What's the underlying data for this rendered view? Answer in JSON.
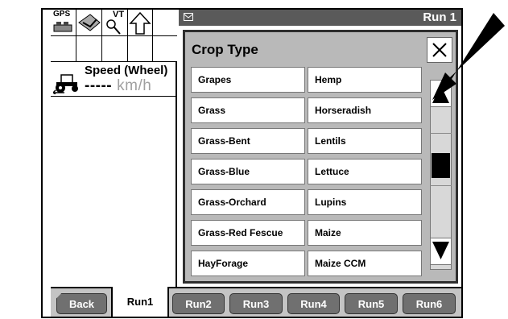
{
  "status_icons": {
    "gps_label": "GPS",
    "vt_label": "VT"
  },
  "speed": {
    "title": "Speed (Wheel)",
    "value": "-----",
    "unit": "km/h"
  },
  "header": {
    "title": "Run 1"
  },
  "dialog": {
    "title": "Crop Type",
    "items_left": [
      "Grapes",
      "Grass",
      "Grass-Bent",
      "Grass-Blue",
      "Grass-Orchard",
      "Grass-Red Fescue",
      "HayForage"
    ],
    "items_right": [
      "Hemp",
      "Horseradish",
      "Lentils",
      "Lettuce",
      "Lupins",
      "Maize",
      "Maize CCM"
    ]
  },
  "tabs": {
    "back": "Back",
    "run1": "Run1",
    "run2": "Run2",
    "run3": "Run3",
    "run4": "Run4",
    "run5": "Run5",
    "run6": "Run6"
  },
  "colors": {
    "dialog_bg": "#b9b9b9",
    "header_bg": "#5a5a5a",
    "tab_bg": "#707070",
    "tabbar_bg": "#c4c4c4"
  }
}
